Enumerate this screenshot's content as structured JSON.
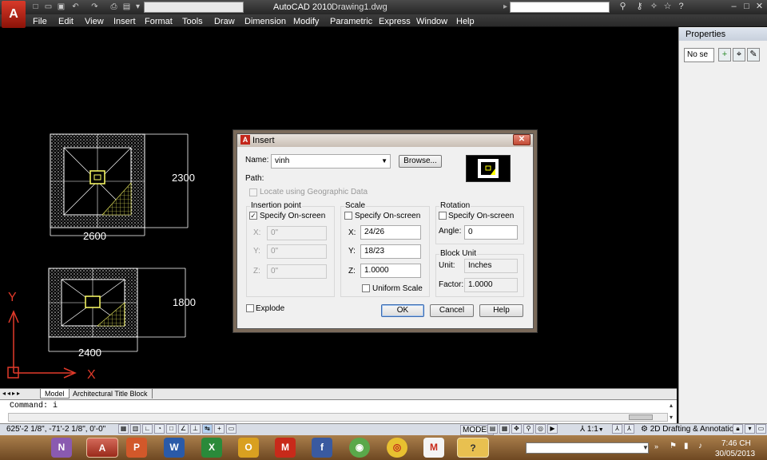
{
  "titlebar": {
    "app_title": "AutoCAD 2010",
    "doc_title": "Drawing1.dwg",
    "workspace": ""
  },
  "menu": [
    "File",
    "Edit",
    "View",
    "Insert",
    "Format",
    "Tools",
    "Draw",
    "Dimension",
    "Modify",
    "Parametric",
    "Express",
    "Window",
    "Help"
  ],
  "drawing": {
    "dims_top": {
      "height": "2300",
      "width": "2600"
    },
    "dims_bottom": {
      "height": "1800",
      "width": "2400"
    },
    "ucs_x": "X",
    "ucs_y": "Y"
  },
  "properties": {
    "title": "Properties",
    "selection": "No se"
  },
  "dialog": {
    "title": "Insert",
    "name_label": "Name:",
    "name_value": "vinh",
    "browse": "Browse...",
    "path_label": "Path:",
    "geo_label": "Locate using Geographic Data",
    "insertion": {
      "title": "Insertion point",
      "specify": "Specify On-screen",
      "x_label": "X:",
      "x_value": "0\"",
      "y_label": "Y:",
      "y_value": "0\"",
      "z_label": "Z:",
      "z_value": "0\""
    },
    "scale": {
      "title": "Scale",
      "specify": "Specify On-screen",
      "x_label": "X:",
      "x_value": "24/26",
      "y_label": "Y:",
      "y_value": "18/23",
      "z_label": "Z:",
      "z_value": "1.0000",
      "uniform": "Uniform Scale"
    },
    "rotation": {
      "title": "Rotation",
      "specify": "Specify On-screen",
      "angle_label": "Angle:",
      "angle_value": "0"
    },
    "block_unit": {
      "title": "Block Unit",
      "unit_label": "Unit:",
      "unit_value": "Inches",
      "factor_label": "Factor:",
      "factor_value": "1.0000"
    },
    "explode": "Explode",
    "ok": "OK",
    "cancel": "Cancel",
    "help": "Help"
  },
  "tabs": [
    "Model",
    "Architectural Title Block"
  ],
  "command": {
    "text": "Command: i"
  },
  "status": {
    "coords": "625'-2 1/8\", -71'-2 1/8\", 0'-0\"",
    "model": "MODEL",
    "scale": "1:1",
    "workspace": "2D Drafting & Annotation"
  },
  "taskbar": {
    "time": "7:46 CH",
    "date": "30/05/2013"
  },
  "colors": {
    "canvas": "#000000",
    "taskbar": "#8a6030",
    "dialog": "#f0f0f0",
    "accent_red": "#c3261a"
  }
}
